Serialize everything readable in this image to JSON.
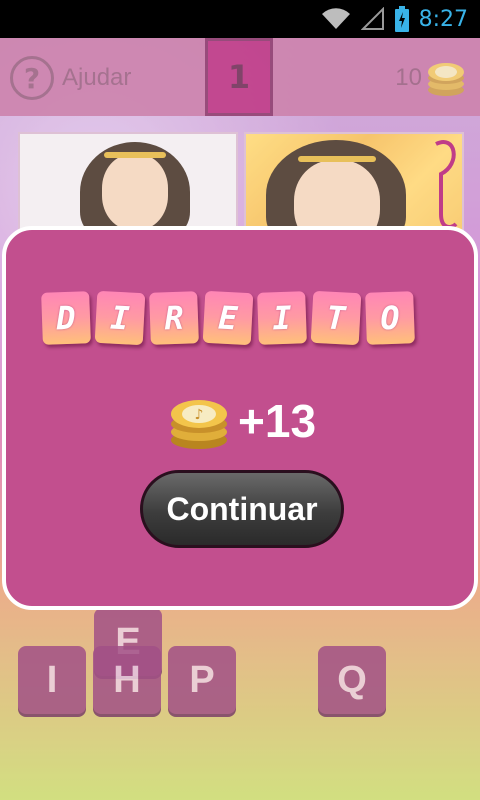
{
  "status": {
    "time": "8:27"
  },
  "topbar": {
    "help_label": "Ajudar",
    "level": "1",
    "coins": "10"
  },
  "keys_visible": [
    {
      "label": "E"
    },
    {
      "label": "I"
    },
    {
      "label": "H"
    },
    {
      "label": "P"
    },
    {
      "label": "Q"
    }
  ],
  "modal": {
    "word_letters": [
      "D",
      "I",
      "R",
      "E",
      "I",
      "T",
      "O"
    ],
    "reward": "+13",
    "continue_label": "Continuar"
  },
  "colors": {
    "modal_bg": "#c24f8e",
    "level_box": "#b3126e",
    "time": "#39b3e8"
  }
}
